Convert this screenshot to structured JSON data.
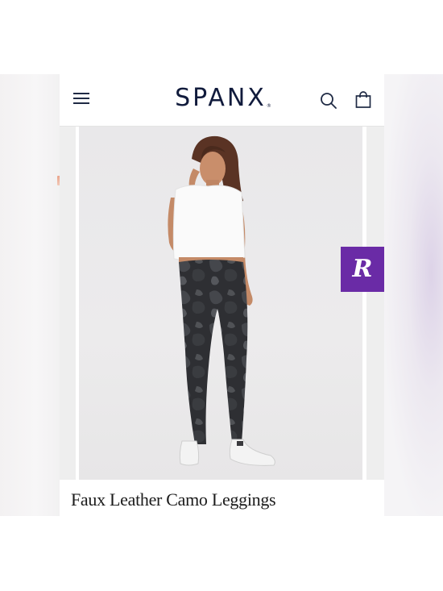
{
  "header": {
    "brand": "SPANX",
    "brand_mark": "®",
    "icons": [
      "menu-icon",
      "search-icon",
      "bag-icon"
    ]
  },
  "product": {
    "title": "Faux Leather Camo Leggings"
  },
  "badge": {
    "letter": "R",
    "color": "#6a2ba6"
  },
  "colors": {
    "brand_navy": "#111b3c"
  }
}
